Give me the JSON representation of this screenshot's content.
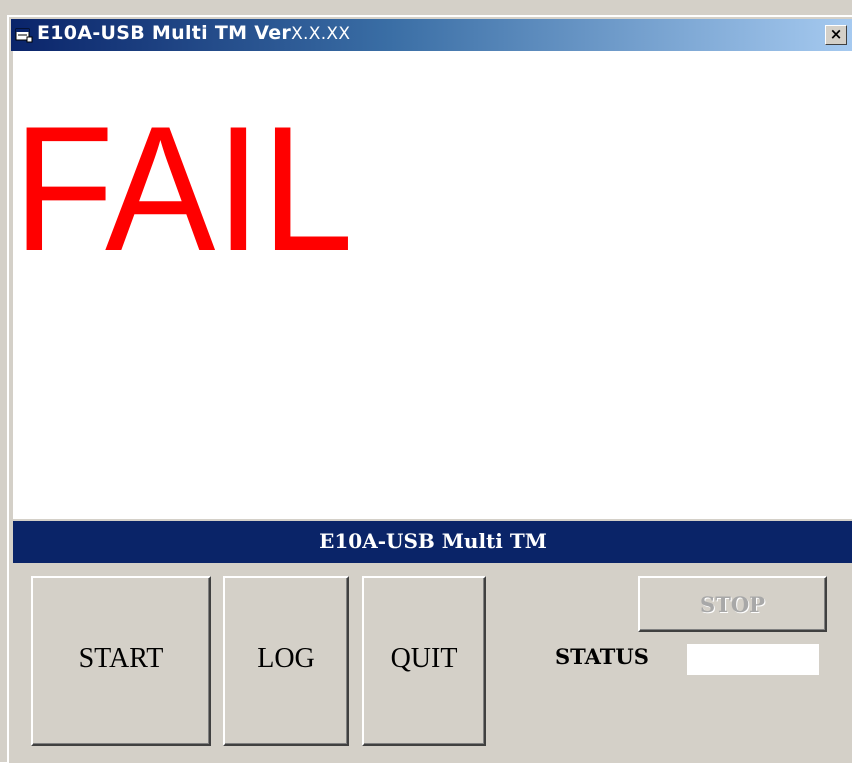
{
  "window": {
    "title_main": "E10A-USB Multi TM Ver",
    "title_version": "X.X.XX",
    "close_glyph": "×"
  },
  "display": {
    "result_text": "FAIL",
    "result_color": "#ff0000"
  },
  "caption_bar": {
    "text": "E10A-USB Multi TM",
    "background": "#0a2468"
  },
  "buttons": {
    "start_label": "START",
    "log_label": "LOG",
    "quit_label": "QUIT",
    "stop_label": "STOP"
  },
  "status": {
    "label": "STATUS",
    "value": ""
  },
  "icons": {
    "app": "app-window-icon",
    "close": "close-icon"
  }
}
